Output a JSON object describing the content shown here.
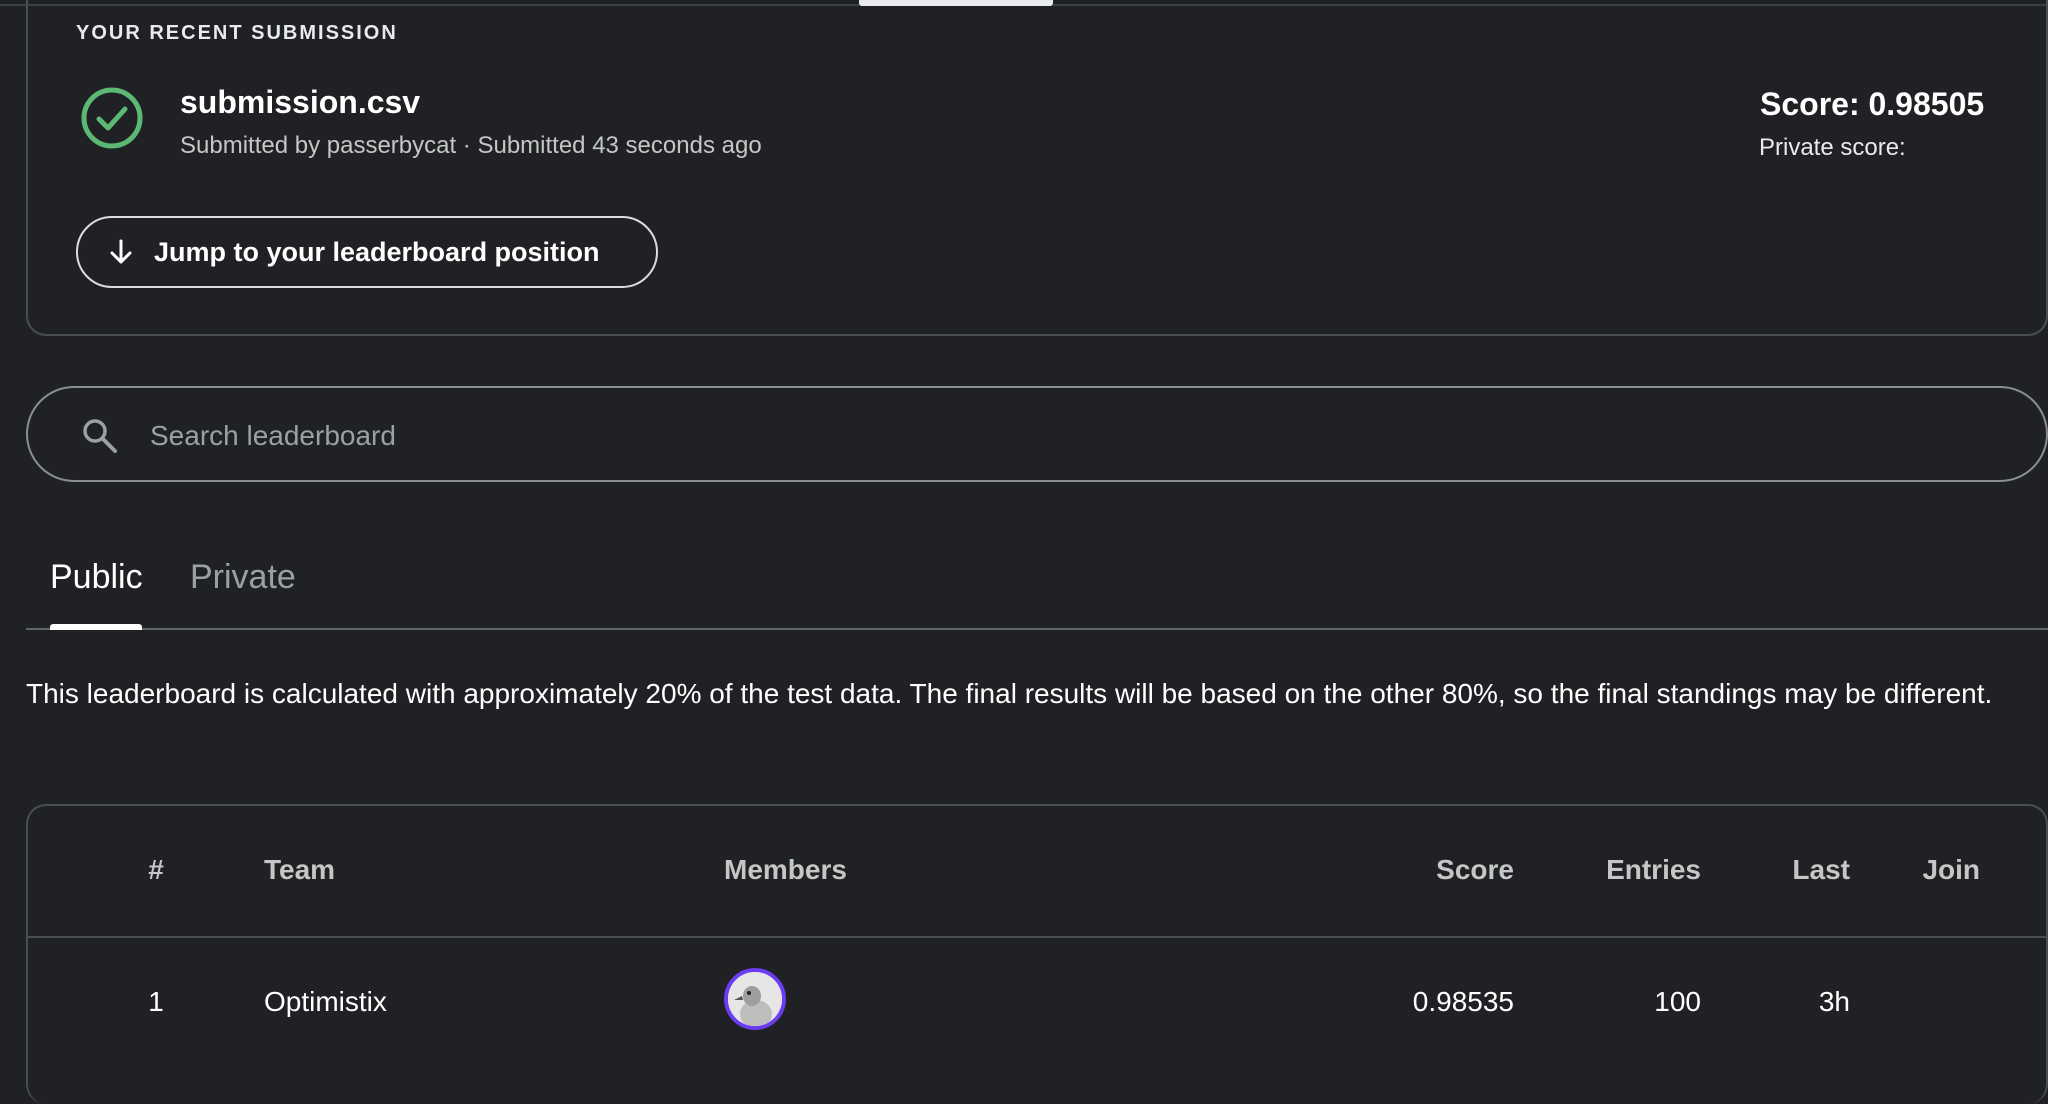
{
  "recent_submission": {
    "section_label": "YOUR RECENT SUBMISSION",
    "file_name": "submission.csv",
    "submitted_line": "Submitted by passerbycat · Submitted 43 seconds ago",
    "score": "Score: 0.98505",
    "private_score": "Private score:",
    "jump_button_label": "Jump to your leaderboard position"
  },
  "search": {
    "placeholder": "Search leaderboard"
  },
  "tabs": [
    {
      "label": "Public",
      "active": true
    },
    {
      "label": "Private",
      "active": false
    }
  ],
  "notice": "This leaderboard is calculated with approximately 20% of the test data. The final results will be based on the other 80%, so the final standings may be different.",
  "table": {
    "headers": {
      "rank": "#",
      "team": "Team",
      "members": "Members",
      "score": "Score",
      "entries": "Entries",
      "last": "Last",
      "join": "Join"
    },
    "rows": [
      {
        "rank": "1",
        "team": "Optimistix",
        "score": "0.98535",
        "entries": "100",
        "last": "3h"
      }
    ]
  },
  "colors": {
    "background": "#202124",
    "success": "#5bb974",
    "avatar_ring": "#6a3df0"
  }
}
